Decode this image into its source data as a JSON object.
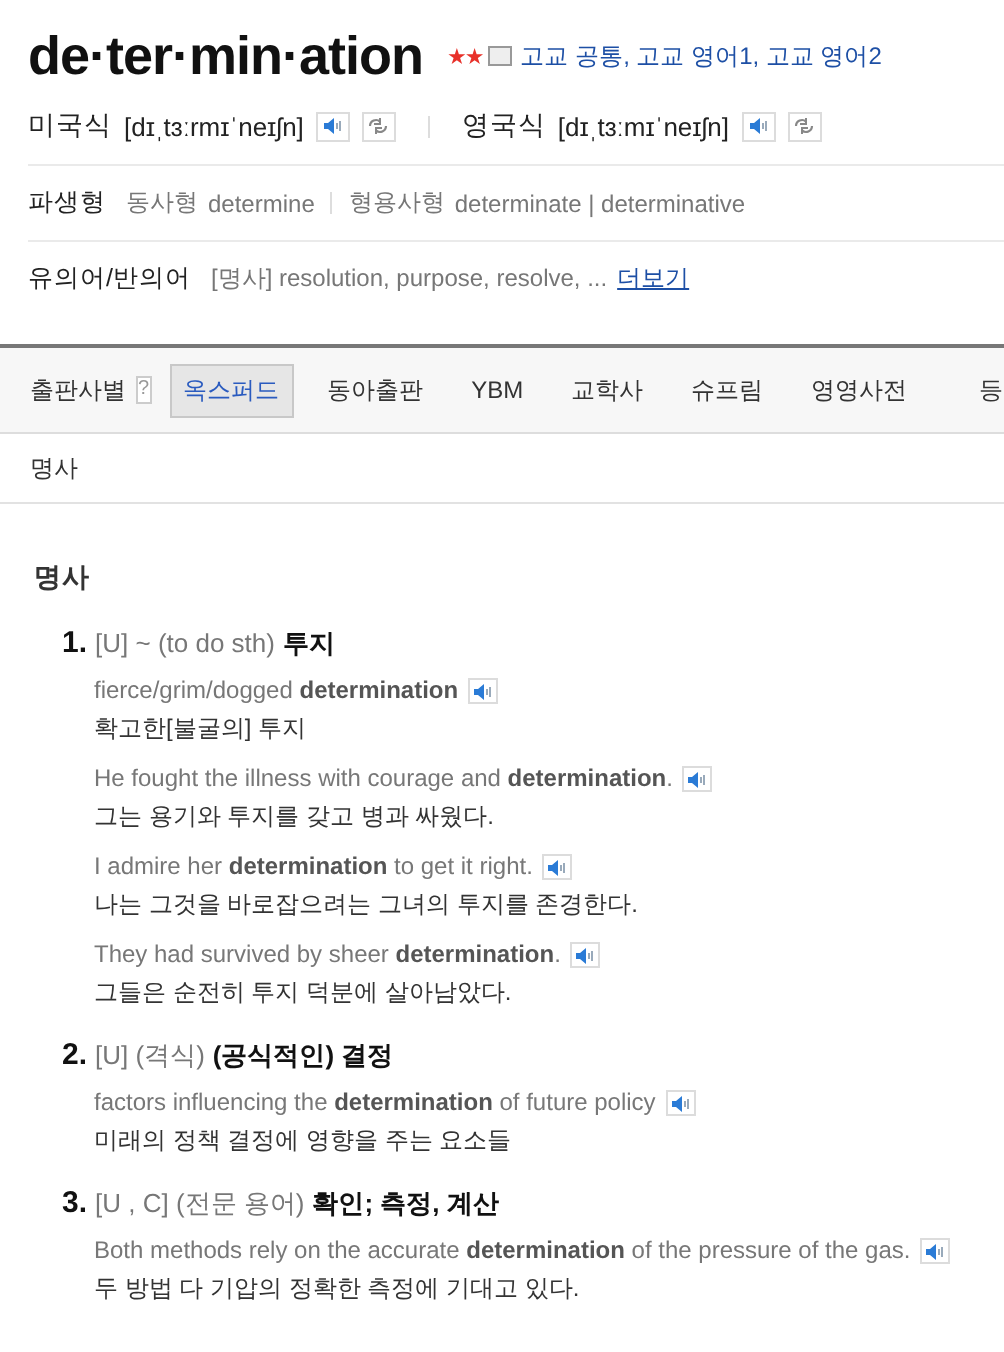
{
  "entry": {
    "headword": "de·ter·min·ation",
    "importance": "★★",
    "levels": "고교 공통, 고교 영어1, 고교 영어2",
    "pronunciations": [
      {
        "label": "미국식",
        "ipa": "[dɪˌtɜːrmɪˈneɪʃn]"
      },
      {
        "label": "영국식",
        "ipa": "[dɪˌtɜːmɪˈneɪʃn]"
      }
    ],
    "derivatives": {
      "label": "파생형",
      "items": [
        {
          "pos": "동사형",
          "word": "determine"
        },
        {
          "pos": "형용사형",
          "word": "determinate | determinative"
        }
      ]
    },
    "synonyms": {
      "label": "유의어/반의어",
      "text": "[명사] resolution, purpose, resolve, ...",
      "more": "더보기"
    }
  },
  "publishers": {
    "label": "출판사별",
    "help": "?",
    "tabs": [
      {
        "label": "옥스퍼드",
        "selected": true
      },
      {
        "label": "동아출판",
        "selected": false
      },
      {
        "label": "YBM",
        "selected": false
      },
      {
        "label": "교학사",
        "selected": false
      },
      {
        "label": "슈프림",
        "selected": false
      },
      {
        "label": "영영사전",
        "selected": false
      },
      {
        "label": "등",
        "selected": false
      }
    ]
  },
  "pos_tabs": [
    "명사"
  ],
  "section": {
    "title": "명사",
    "senses": [
      {
        "number": "1.",
        "grammar": "[U] ~ (to do sth)",
        "meaning": "투지",
        "examples": [
          {
            "en": "fierce/grim/dogged **determination**",
            "ko": "확고한[불굴의] 투지"
          },
          {
            "en": "He fought the illness with courage and **determination**.",
            "ko": "그는 용기와 투지를 갖고 병과 싸웠다."
          },
          {
            "en": "I admire her **determination** to get it right.",
            "ko": "나는 그것을 바로잡으려는 그녀의 투지를 존경한다."
          },
          {
            "en": "They had survived by sheer **determination**.",
            "ko": "그들은 순전히 투지 덕분에 살아남았다."
          }
        ]
      },
      {
        "number": "2.",
        "grammar": "[U] (격식)",
        "meaning": "(공식적인) 결정",
        "examples": [
          {
            "en": "factors influencing the **determination** of future policy",
            "ko": "미래의 정책 결정에 영향을 주는 요소들"
          }
        ]
      },
      {
        "number": "3.",
        "grammar": "[U , C] (전문 용어)",
        "meaning": "확인; 측정, 계산",
        "examples": [
          {
            "en": "Both methods rely on the accurate **determination** of the pressure of the gas.",
            "ko": "두 방법 다 기압의 정확한 측정에 기대고 있다."
          }
        ]
      }
    ]
  }
}
